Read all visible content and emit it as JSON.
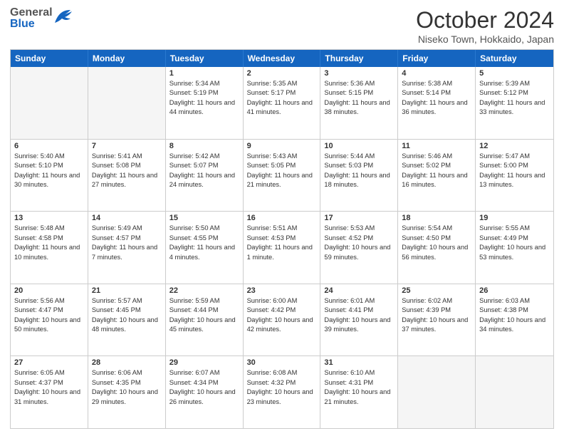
{
  "header": {
    "logo_general": "General",
    "logo_blue": "Blue",
    "title": "October 2024",
    "subtitle": "Niseko Town, Hokkaido, Japan"
  },
  "days_of_week": [
    "Sunday",
    "Monday",
    "Tuesday",
    "Wednesday",
    "Thursday",
    "Friday",
    "Saturday"
  ],
  "weeks": [
    [
      {
        "day": "",
        "sunrise": "",
        "sunset": "",
        "daylight": "",
        "empty": true
      },
      {
        "day": "",
        "sunrise": "",
        "sunset": "",
        "daylight": "",
        "empty": true
      },
      {
        "day": "1",
        "sunrise": "Sunrise: 5:34 AM",
        "sunset": "Sunset: 5:19 PM",
        "daylight": "Daylight: 11 hours and 44 minutes.",
        "empty": false
      },
      {
        "day": "2",
        "sunrise": "Sunrise: 5:35 AM",
        "sunset": "Sunset: 5:17 PM",
        "daylight": "Daylight: 11 hours and 41 minutes.",
        "empty": false
      },
      {
        "day": "3",
        "sunrise": "Sunrise: 5:36 AM",
        "sunset": "Sunset: 5:15 PM",
        "daylight": "Daylight: 11 hours and 38 minutes.",
        "empty": false
      },
      {
        "day": "4",
        "sunrise": "Sunrise: 5:38 AM",
        "sunset": "Sunset: 5:14 PM",
        "daylight": "Daylight: 11 hours and 36 minutes.",
        "empty": false
      },
      {
        "day": "5",
        "sunrise": "Sunrise: 5:39 AM",
        "sunset": "Sunset: 5:12 PM",
        "daylight": "Daylight: 11 hours and 33 minutes.",
        "empty": false
      }
    ],
    [
      {
        "day": "6",
        "sunrise": "Sunrise: 5:40 AM",
        "sunset": "Sunset: 5:10 PM",
        "daylight": "Daylight: 11 hours and 30 minutes.",
        "empty": false
      },
      {
        "day": "7",
        "sunrise": "Sunrise: 5:41 AM",
        "sunset": "Sunset: 5:08 PM",
        "daylight": "Daylight: 11 hours and 27 minutes.",
        "empty": false
      },
      {
        "day": "8",
        "sunrise": "Sunrise: 5:42 AM",
        "sunset": "Sunset: 5:07 PM",
        "daylight": "Daylight: 11 hours and 24 minutes.",
        "empty": false
      },
      {
        "day": "9",
        "sunrise": "Sunrise: 5:43 AM",
        "sunset": "Sunset: 5:05 PM",
        "daylight": "Daylight: 11 hours and 21 minutes.",
        "empty": false
      },
      {
        "day": "10",
        "sunrise": "Sunrise: 5:44 AM",
        "sunset": "Sunset: 5:03 PM",
        "daylight": "Daylight: 11 hours and 18 minutes.",
        "empty": false
      },
      {
        "day": "11",
        "sunrise": "Sunrise: 5:46 AM",
        "sunset": "Sunset: 5:02 PM",
        "daylight": "Daylight: 11 hours and 16 minutes.",
        "empty": false
      },
      {
        "day": "12",
        "sunrise": "Sunrise: 5:47 AM",
        "sunset": "Sunset: 5:00 PM",
        "daylight": "Daylight: 11 hours and 13 minutes.",
        "empty": false
      }
    ],
    [
      {
        "day": "13",
        "sunrise": "Sunrise: 5:48 AM",
        "sunset": "Sunset: 4:58 PM",
        "daylight": "Daylight: 11 hours and 10 minutes.",
        "empty": false
      },
      {
        "day": "14",
        "sunrise": "Sunrise: 5:49 AM",
        "sunset": "Sunset: 4:57 PM",
        "daylight": "Daylight: 11 hours and 7 minutes.",
        "empty": false
      },
      {
        "day": "15",
        "sunrise": "Sunrise: 5:50 AM",
        "sunset": "Sunset: 4:55 PM",
        "daylight": "Daylight: 11 hours and 4 minutes.",
        "empty": false
      },
      {
        "day": "16",
        "sunrise": "Sunrise: 5:51 AM",
        "sunset": "Sunset: 4:53 PM",
        "daylight": "Daylight: 11 hours and 1 minute.",
        "empty": false
      },
      {
        "day": "17",
        "sunrise": "Sunrise: 5:53 AM",
        "sunset": "Sunset: 4:52 PM",
        "daylight": "Daylight: 10 hours and 59 minutes.",
        "empty": false
      },
      {
        "day": "18",
        "sunrise": "Sunrise: 5:54 AM",
        "sunset": "Sunset: 4:50 PM",
        "daylight": "Daylight: 10 hours and 56 minutes.",
        "empty": false
      },
      {
        "day": "19",
        "sunrise": "Sunrise: 5:55 AM",
        "sunset": "Sunset: 4:49 PM",
        "daylight": "Daylight: 10 hours and 53 minutes.",
        "empty": false
      }
    ],
    [
      {
        "day": "20",
        "sunrise": "Sunrise: 5:56 AM",
        "sunset": "Sunset: 4:47 PM",
        "daylight": "Daylight: 10 hours and 50 minutes.",
        "empty": false
      },
      {
        "day": "21",
        "sunrise": "Sunrise: 5:57 AM",
        "sunset": "Sunset: 4:45 PM",
        "daylight": "Daylight: 10 hours and 48 minutes.",
        "empty": false
      },
      {
        "day": "22",
        "sunrise": "Sunrise: 5:59 AM",
        "sunset": "Sunset: 4:44 PM",
        "daylight": "Daylight: 10 hours and 45 minutes.",
        "empty": false
      },
      {
        "day": "23",
        "sunrise": "Sunrise: 6:00 AM",
        "sunset": "Sunset: 4:42 PM",
        "daylight": "Daylight: 10 hours and 42 minutes.",
        "empty": false
      },
      {
        "day": "24",
        "sunrise": "Sunrise: 6:01 AM",
        "sunset": "Sunset: 4:41 PM",
        "daylight": "Daylight: 10 hours and 39 minutes.",
        "empty": false
      },
      {
        "day": "25",
        "sunrise": "Sunrise: 6:02 AM",
        "sunset": "Sunset: 4:39 PM",
        "daylight": "Daylight: 10 hours and 37 minutes.",
        "empty": false
      },
      {
        "day": "26",
        "sunrise": "Sunrise: 6:03 AM",
        "sunset": "Sunset: 4:38 PM",
        "daylight": "Daylight: 10 hours and 34 minutes.",
        "empty": false
      }
    ],
    [
      {
        "day": "27",
        "sunrise": "Sunrise: 6:05 AM",
        "sunset": "Sunset: 4:37 PM",
        "daylight": "Daylight: 10 hours and 31 minutes.",
        "empty": false
      },
      {
        "day": "28",
        "sunrise": "Sunrise: 6:06 AM",
        "sunset": "Sunset: 4:35 PM",
        "daylight": "Daylight: 10 hours and 29 minutes.",
        "empty": false
      },
      {
        "day": "29",
        "sunrise": "Sunrise: 6:07 AM",
        "sunset": "Sunset: 4:34 PM",
        "daylight": "Daylight: 10 hours and 26 minutes.",
        "empty": false
      },
      {
        "day": "30",
        "sunrise": "Sunrise: 6:08 AM",
        "sunset": "Sunset: 4:32 PM",
        "daylight": "Daylight: 10 hours and 23 minutes.",
        "empty": false
      },
      {
        "day": "31",
        "sunrise": "Sunrise: 6:10 AM",
        "sunset": "Sunset: 4:31 PM",
        "daylight": "Daylight: 10 hours and 21 minutes.",
        "empty": false
      },
      {
        "day": "",
        "sunrise": "",
        "sunset": "",
        "daylight": "",
        "empty": true
      },
      {
        "day": "",
        "sunrise": "",
        "sunset": "",
        "daylight": "",
        "empty": true
      }
    ]
  ]
}
